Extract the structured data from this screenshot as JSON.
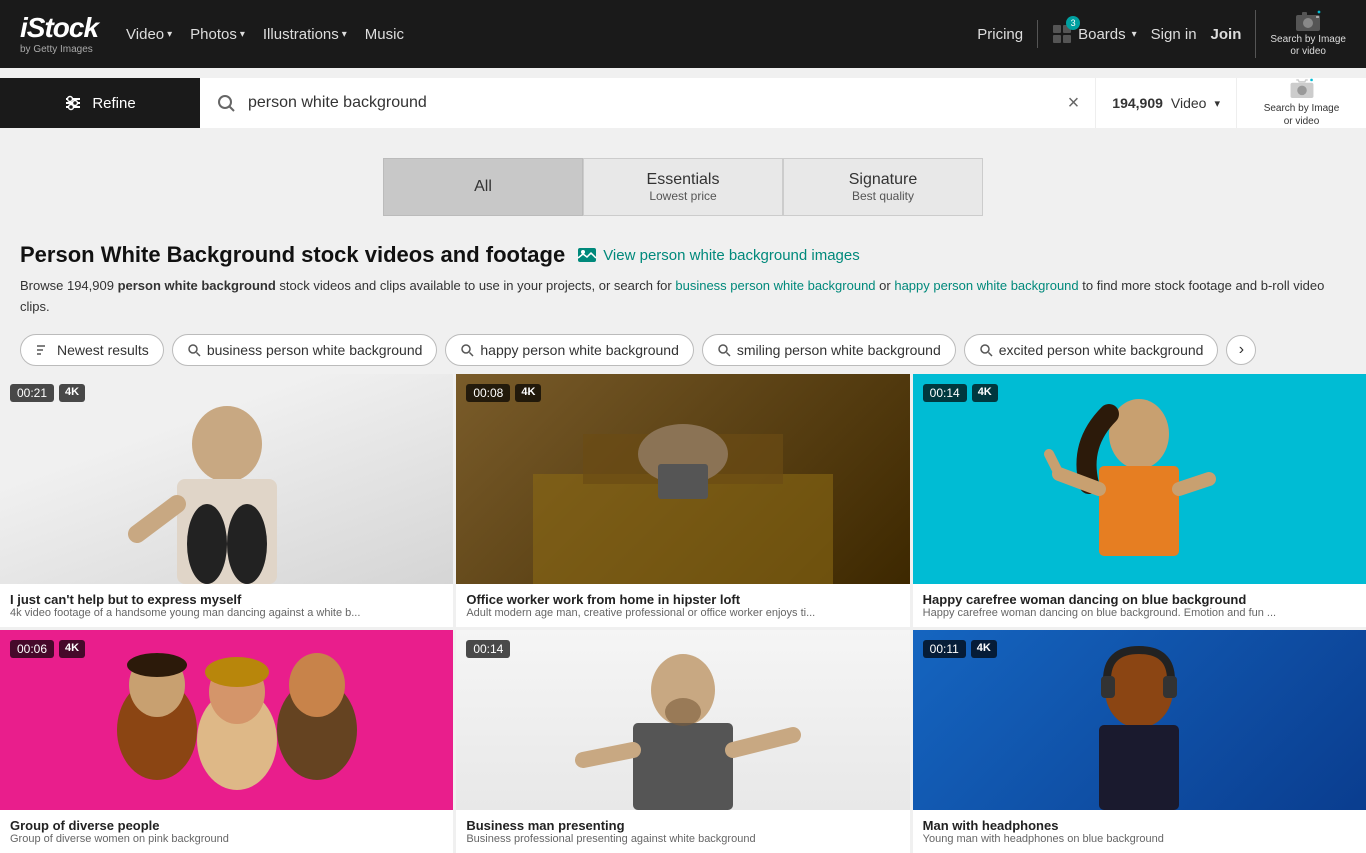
{
  "header": {
    "logo": "iStock",
    "logo_sub": "by Getty Images",
    "nav_items": [
      {
        "label": "Video",
        "has_dropdown": true
      },
      {
        "label": "Photos",
        "has_dropdown": true
      },
      {
        "label": "Illustrations",
        "has_dropdown": true
      },
      {
        "label": "Music",
        "has_dropdown": false
      }
    ],
    "pricing": "Pricing",
    "boards": "Boards",
    "boards_count": "3",
    "sign_in": "Sign in",
    "join": "Join",
    "search_by_image": "Search by Image\nor video"
  },
  "search": {
    "query": "person white background",
    "placeholder": "Search",
    "results_count": "194,909",
    "filter_label": "Video",
    "clear_label": "×"
  },
  "refine": {
    "label": "Refine"
  },
  "tabs": [
    {
      "label": "All",
      "sub": "",
      "active": true
    },
    {
      "label": "Essentials",
      "sub": "Lowest price",
      "active": false
    },
    {
      "label": "Signature",
      "sub": "Best quality",
      "active": false
    }
  ],
  "page_title": "Person White Background stock videos and footage",
  "view_images_link": "View person white background images",
  "description": "Browse 194,909 ",
  "description_bold": "person white background",
  "description_rest": " stock videos and clips available to use in your projects, or search for ",
  "related_link_1": "business person white background",
  "description_or": " or ",
  "related_link_2": "happy person white background",
  "description_end": " to find more stock footage and b-roll video clips.",
  "chips": [
    {
      "label": "Newest results",
      "icon": "⇅",
      "type": "sort"
    },
    {
      "label": "business person white background",
      "icon": "🔍",
      "type": "search"
    },
    {
      "label": "happy person white background",
      "icon": "🔍",
      "type": "search"
    },
    {
      "label": "smiling person white background",
      "icon": "🔍",
      "type": "search"
    },
    {
      "label": "excited person white background",
      "icon": "🔍",
      "type": "search"
    }
  ],
  "videos": [
    {
      "duration": "00:21",
      "quality": "4K",
      "title": "I just can't help but to express myself",
      "description": "4k video footage of a handsome young man dancing against a white b...",
      "bg_color": "#e8e8e8",
      "type": "light"
    },
    {
      "duration": "00:08",
      "quality": "4K",
      "title": "Office worker work from home in hipster loft",
      "description": "Adult modern age man, creative professional or office worker enjoys ti...",
      "bg_color": "#6b4c1e",
      "type": "dark"
    },
    {
      "duration": "00:14",
      "quality": "4K",
      "title": "Happy carefree woman dancing on blue background",
      "description": "Happy carefree woman dancing on blue background. Emotion and fun ...",
      "bg_color": "#00bcd4",
      "type": "cyan"
    },
    {
      "duration": "00:06",
      "quality": "4K",
      "title": "Group of diverse people",
      "description": "Group of diverse women on pink background",
      "bg_color": "#e91e8c",
      "type": "pink"
    },
    {
      "duration": "00:14",
      "quality": "",
      "title": "Business man presenting",
      "description": "Business professional presenting against white background",
      "bg_color": "#f0f0f0",
      "type": "light2"
    },
    {
      "duration": "00:11",
      "quality": "4K",
      "title": "Man with headphones",
      "description": "Young man with headphones on blue background",
      "bg_color": "#1565c0",
      "type": "blue"
    }
  ]
}
